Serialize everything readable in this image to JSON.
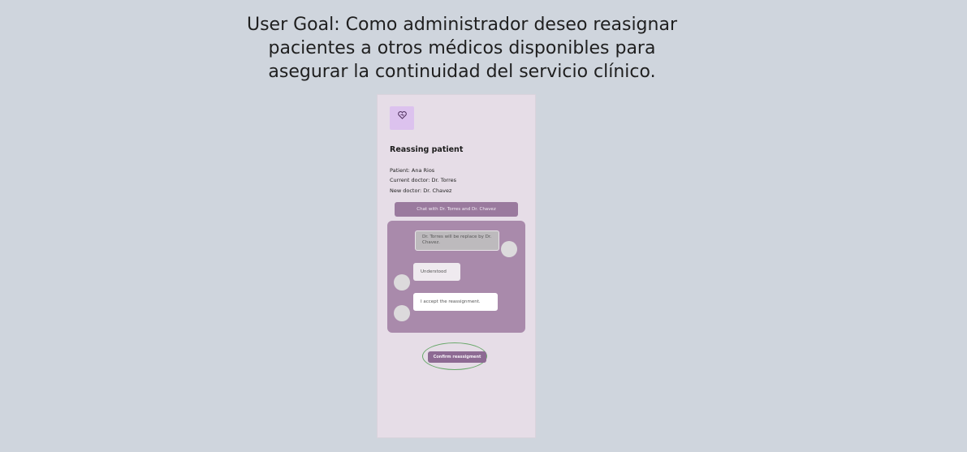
{
  "goal": {
    "line1": "User Goal: Como administrador deseo reasignar",
    "line2": "pacientes a otros médicos disponibles para",
    "line3": "asegurar la continuidad del servicio clínico."
  },
  "app": {
    "logo_icon": "heart-icon",
    "title": "Reassing patient",
    "patient": "Patient: Ana Rios",
    "current_doctor": "Current doctor: Dr. Torres",
    "new_doctor": "New doctor: Dr. Chavez",
    "chat_title": "Chat with Dr. Torres and Dr. Chavez",
    "messages": [
      {
        "text": "Dr. Torres will be replace by Dr. Chavez."
      },
      {
        "text": "Understood"
      },
      {
        "text": "I accept the reassignment."
      }
    ],
    "confirm_label": "Confirm reassigment"
  },
  "colors": {
    "background": "#cfd5dd",
    "screen": "#e6dde7",
    "accent": "#9a7a9e",
    "chat_panel": "#a98aab",
    "highlight_ring": "#68a86a"
  }
}
